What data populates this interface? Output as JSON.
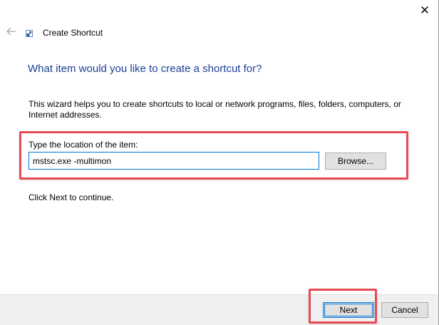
{
  "window": {
    "title": "Create Shortcut",
    "icons": {
      "close": "close-icon",
      "back": "back-arrow-icon",
      "title": "shortcut-icon"
    }
  },
  "main": {
    "heading": "What item would you like to create a shortcut for?",
    "description": "This wizard helps you to create shortcuts to local or network programs, files, folders, computers, or Internet addresses.",
    "location_label": "Type the location of the item:",
    "location_value": "mstsc.exe -multimon",
    "browse_label": "Browse...",
    "continue_text": "Click Next to continue."
  },
  "footer": {
    "next_label": "Next",
    "cancel_label": "Cancel"
  },
  "colors": {
    "heading": "#1c3f94",
    "highlight": "#e94a55",
    "focus": "#0078d7",
    "button_bg": "#e1e1e1",
    "footer_bg": "#f0f0f0"
  }
}
